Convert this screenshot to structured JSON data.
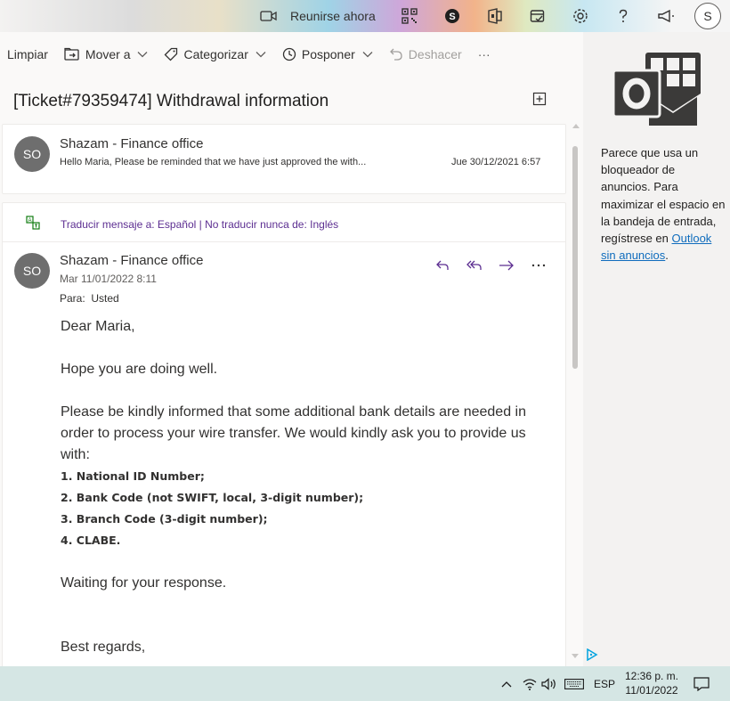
{
  "header": {
    "meet_label": "Reunirse ahora",
    "avatar_initial": "S"
  },
  "toolbar": {
    "clean": "Limpiar",
    "move": "Mover a",
    "categorize": "Categorizar",
    "snooze": "Posponer",
    "undo": "Deshacer",
    "more": "···"
  },
  "thread": {
    "subject": "[Ticket#79359474] Withdrawal information",
    "first": {
      "initials": "SO",
      "sender": "Shazam - Finance office",
      "preview": "Hello Maria, Please be reminded that we have just approved the with...",
      "date": "Jue 30/12/2021 6:57"
    },
    "translate": "Traducir mensaje a: Español | No traducir nunca de: Inglés",
    "message": {
      "initials": "SO",
      "sender": "Shazam - Finance office",
      "date": "Mar 11/01/2022 8:11",
      "to_label": "Para:",
      "to_value": "Usted",
      "greeting": "Dear Maria,",
      "line1": "Hope you are doing well.",
      "line2": "Please be kindly informed that some additional bank details are needed in order to process your wire transfer. We would kindly ask you to provide us with:",
      "items": [
        "1. National ID Number;",
        "2. Bank Code (not SWIFT, local, 3-digit number);",
        "3. Branch Code (3-digit number);",
        "4. CLABE."
      ],
      "line3": "Waiting for your response.",
      "closing": "Best regards,"
    }
  },
  "ad_panel": {
    "text": "Parece que usa un bloqueador de anuncios. Para maximizar el espacio en la bandeja de entrada, regístrese en",
    "link": "Outlook sin anuncios",
    "suffix": "."
  },
  "taskbar": {
    "lang": "ESP",
    "time": "12:36 p. m.",
    "date": "11/01/2022"
  },
  "colors": {
    "accent": "#0f6cbd",
    "translate_link": "#5c2e91",
    "persona": "#6e6e6e",
    "taskbar": "#d5e6e4"
  }
}
